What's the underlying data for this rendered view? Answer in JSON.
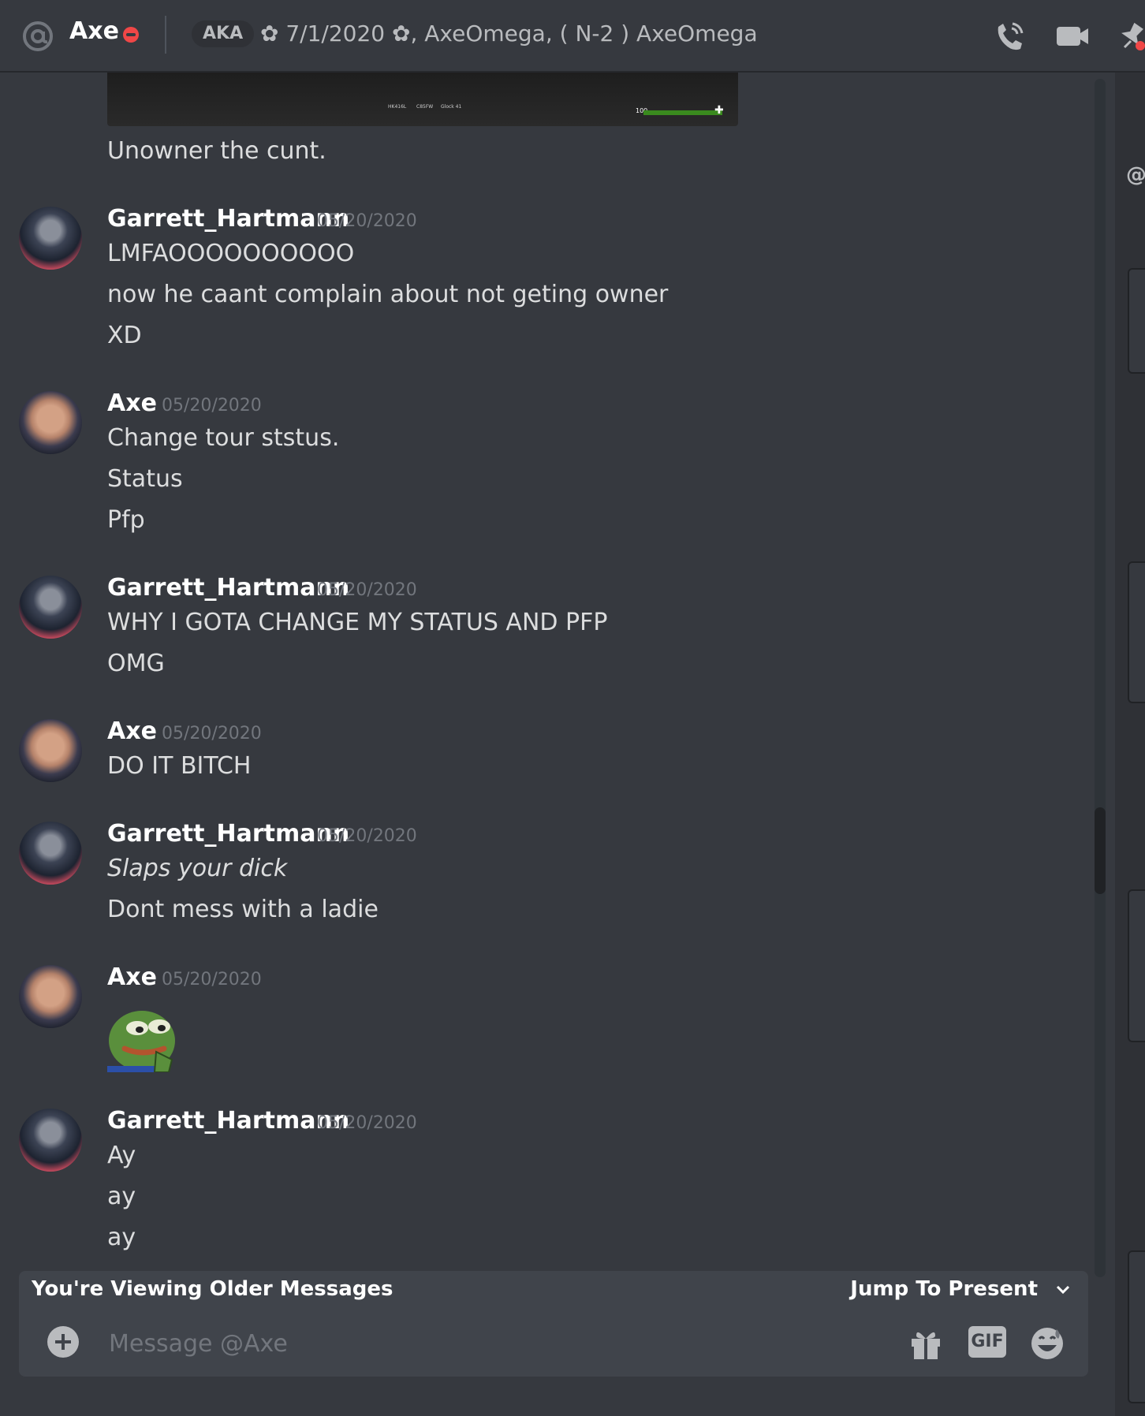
{
  "header": {
    "dm_name": "Axe",
    "aka_label": "AKA",
    "status_text": "✿ 7/1/2020 ✿, AxeOmega, ( N-2 ) AxeOmega",
    "icons": [
      "at-icon",
      "do-not-disturb-icon",
      "call-icon",
      "video-icon",
      "pin-icon"
    ]
  },
  "embed": {
    "hp_value": "100",
    "slots": [
      "HK416L",
      "C85FW",
      "Glock 41"
    ]
  },
  "messages": [
    {
      "type": "continuation",
      "lines": [
        "Unowner the cunt."
      ]
    },
    {
      "author": "Garrett_Hartmann",
      "timestamp": "05/20/2020",
      "lines": [
        "LMFAOOOOOOOOOO",
        "now he caant complain about not geting owner",
        "XD"
      ]
    },
    {
      "author": "Axe",
      "timestamp": "05/20/2020",
      "lines": [
        "Change tour ststus.",
        "Status",
        "Pfp"
      ]
    },
    {
      "author": "Garrett_Hartmann",
      "timestamp": "05/20/2020",
      "lines": [
        "WHY I GOTA CHANGE MY STATUS AND PFP",
        "OMG"
      ]
    },
    {
      "author": "Axe",
      "timestamp": "05/20/2020",
      "lines": [
        "DO IT BITCH"
      ]
    },
    {
      "author": "Garrett_Hartmann",
      "timestamp": "05/20/2020",
      "lines": [
        "Slaps your dick",
        "Dont mess with a ladie"
      ]
    },
    {
      "author": "Axe",
      "timestamp": "05/20/2020",
      "lines": [],
      "sticker": "pepe-frog-sticker"
    },
    {
      "author": "Garrett_Hartmann",
      "timestamp": "05/20/2020",
      "lines": [
        "Ay",
        "ay",
        "ay"
      ]
    }
  ],
  "older_messages_bar": {
    "label": "You're Viewing Older Messages",
    "jump_label": "Jump To Present"
  },
  "composer": {
    "placeholder": "Message @Axe",
    "gif_label": "GIF"
  },
  "colors": {
    "background": "#36393f",
    "sidebar": "#2f3136",
    "composer": "#40444b",
    "dnd_red": "#f04747",
    "timestamp": "#72767d"
  }
}
